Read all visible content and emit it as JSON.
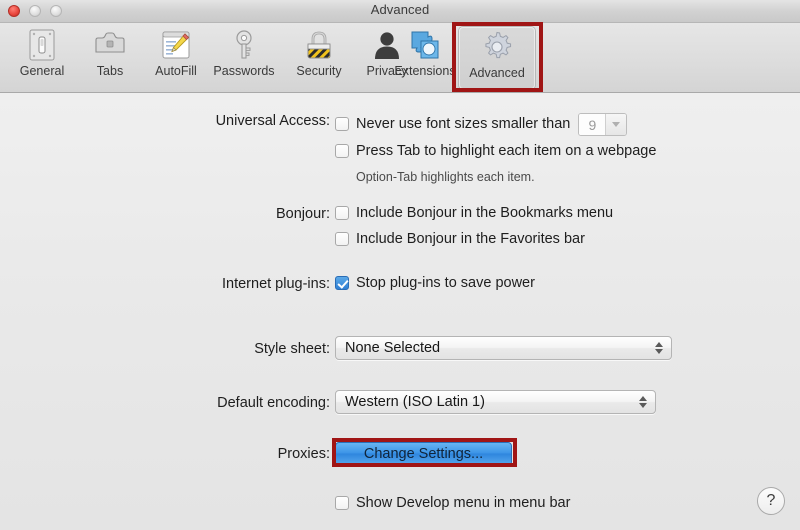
{
  "window": {
    "title": "Advanced",
    "controls": {
      "close": "close-button",
      "minimize": "minimize-button",
      "zoom": "zoom-button"
    }
  },
  "toolbar": {
    "items": [
      {
        "label": "General",
        "icon": "switchplate-icon",
        "selected": false
      },
      {
        "label": "Tabs",
        "icon": "tabs-icon",
        "selected": false
      },
      {
        "label": "AutoFill",
        "icon": "autofill-icon",
        "selected": false
      },
      {
        "label": "Passwords",
        "icon": "key-icon",
        "selected": false
      },
      {
        "label": "Security",
        "icon": "padlock-icon",
        "selected": false
      },
      {
        "label": "Privacy",
        "icon": "person-icon",
        "selected": false
      },
      {
        "label": "Extensions",
        "icon": "puzzle-icon",
        "selected": false
      },
      {
        "label": "Advanced",
        "icon": "gear-icon",
        "selected": true
      }
    ]
  },
  "settings": {
    "universal_access": {
      "label": "Universal Access:",
      "never_use_font_sizes": {
        "label": "Never use font sizes smaller than",
        "checked": false,
        "font_size_value": "9",
        "font_size_disabled": true
      },
      "press_tab": {
        "label": "Press Tab to highlight each item on a webpage",
        "checked": false
      },
      "hint": "Option-Tab highlights each item."
    },
    "bonjour": {
      "label": "Bonjour:",
      "bookmarks_menu": {
        "label": "Include Bonjour in the Bookmarks menu",
        "checked": false
      },
      "favorites_bar": {
        "label": "Include Bonjour in the Favorites bar",
        "checked": false
      }
    },
    "internet_plugins": {
      "label": "Internet plug-ins:",
      "stop_plugins": {
        "label": "Stop plug-ins to save power",
        "checked": true
      }
    },
    "style_sheet": {
      "label": "Style sheet:",
      "value": "None Selected"
    },
    "default_encoding": {
      "label": "Default encoding:",
      "value": "Western (ISO Latin 1)"
    },
    "proxies": {
      "label": "Proxies:",
      "button_label": "Change Settings..."
    },
    "develop_menu": {
      "label": "Show Develop menu in menu bar",
      "checked": false
    },
    "help": {
      "label": "?"
    }
  },
  "annotations": {
    "accent_color": "#a01515",
    "targets": [
      "advanced-toolbar-item",
      "proxies-change-settings-button"
    ]
  }
}
